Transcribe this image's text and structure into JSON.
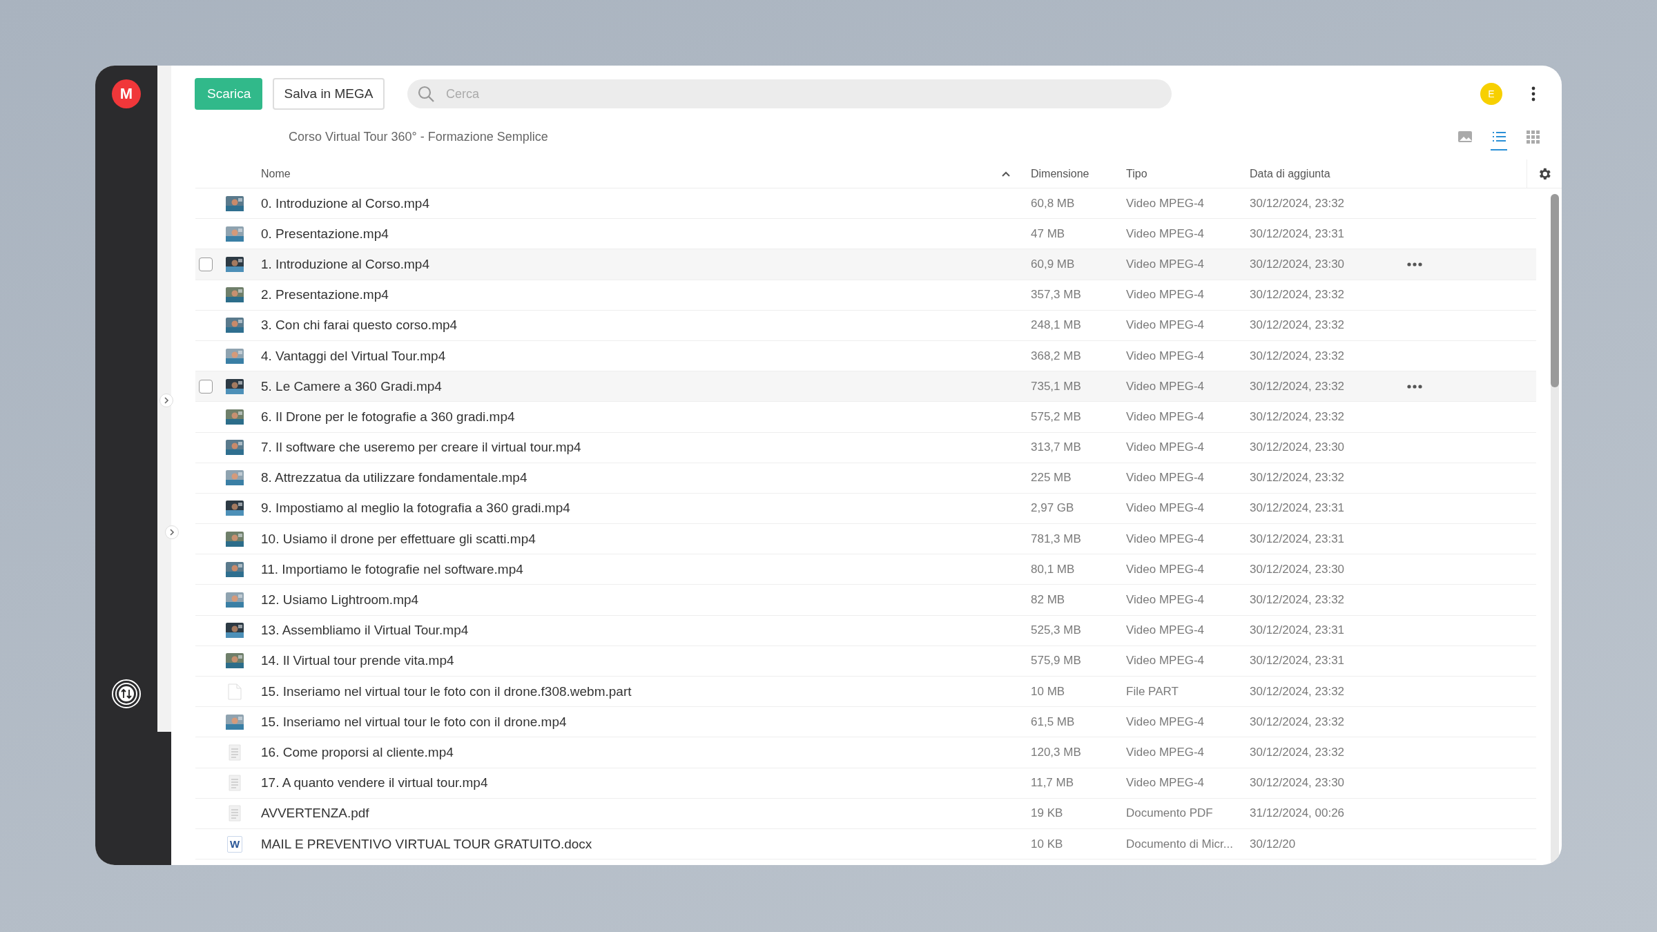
{
  "app": {
    "logo": "M"
  },
  "toolbar": {
    "buttons": [
      {
        "label": "Scarica",
        "kind": "primary"
      },
      {
        "label": "Salva in MEGA",
        "kind": "secondary"
      }
    ],
    "search": {
      "placeholder": "Cerca"
    },
    "user": {
      "initial": "E"
    }
  },
  "breadcrumb": "Corso Virtual Tour 360° - Formazione Semplice",
  "views": [
    {
      "kind": "thumbnails",
      "selected": false
    },
    {
      "kind": "list",
      "selected": true
    },
    {
      "kind": "grid",
      "selected": false
    }
  ],
  "table": {
    "columns": [
      "Nome",
      "Dimensione",
      "Tipo",
      "Data di aggiunta"
    ],
    "rows": [
      {
        "name": "0. Introduzione al Corso.mp4",
        "size": "60,8 MB",
        "type": "Video MPEG-4",
        "date": "30/12/2024, 23:32",
        "kind": "picture",
        "hovered": false
      },
      {
        "name": "0. Presentazione.mp4",
        "size": "47 MB",
        "type": "Video MPEG-4",
        "date": "30/12/2024, 23:31",
        "kind": "picture",
        "hovered": false
      },
      {
        "name": "1. Introduzione al Corso.mp4",
        "size": "60,9 MB",
        "type": "Video MPEG-4",
        "date": "30/12/2024, 23:30",
        "kind": "picture",
        "hovered": true
      },
      {
        "name": "2. Presentazione.mp4",
        "size": "357,3 MB",
        "type": "Video MPEG-4",
        "date": "30/12/2024, 23:32",
        "kind": "picture",
        "hovered": false
      },
      {
        "name": "3. Con chi farai questo corso.mp4",
        "size": "248,1 MB",
        "type": "Video MPEG-4",
        "date": "30/12/2024, 23:32",
        "kind": "picture",
        "hovered": false
      },
      {
        "name": "4. Vantaggi del Virtual Tour.mp4",
        "size": "368,2 MB",
        "type": "Video MPEG-4",
        "date": "30/12/2024, 23:32",
        "kind": "picture",
        "hovered": false
      },
      {
        "name": "5. Le Camere a 360 Gradi.mp4",
        "size": "735,1 MB",
        "type": "Video MPEG-4",
        "date": "30/12/2024, 23:32",
        "kind": "picture",
        "hovered": true
      },
      {
        "name": "6. Il Drone per le fotografie a 360 gradi.mp4",
        "size": "575,2 MB",
        "type": "Video MPEG-4",
        "date": "30/12/2024, 23:32",
        "kind": "picture",
        "hovered": false
      },
      {
        "name": "7. Il software che useremo per creare il virtual tour.mp4",
        "size": "313,7 MB",
        "type": "Video MPEG-4",
        "date": "30/12/2024, 23:30",
        "kind": "picture",
        "hovered": false
      },
      {
        "name": "8. Attrezzatua da utilizzare fondamentale.mp4",
        "size": "225 MB",
        "type": "Video MPEG-4",
        "date": "30/12/2024, 23:32",
        "kind": "picture",
        "hovered": false
      },
      {
        "name": "9. Impostiamo al meglio la fotografia a 360 gradi.mp4",
        "size": "2,97 GB",
        "type": "Video MPEG-4",
        "date": "30/12/2024, 23:31",
        "kind": "picture",
        "hovered": false
      },
      {
        "name": "10. Usiamo il drone per effettuare gli scatti.mp4",
        "size": "781,3 MB",
        "type": "Video MPEG-4",
        "date": "30/12/2024, 23:31",
        "kind": "picture",
        "hovered": false
      },
      {
        "name": "11. Importiamo le fotografie nel software.mp4",
        "size": "80,1 MB",
        "type": "Video MPEG-4",
        "date": "30/12/2024, 23:30",
        "kind": "picture",
        "hovered": false
      },
      {
        "name": "12. Usiamo Lightroom.mp4",
        "size": "82 MB",
        "type": "Video MPEG-4",
        "date": "30/12/2024, 23:32",
        "kind": "picture",
        "hovered": false
      },
      {
        "name": "13. Assembliamo il Virtual Tour.mp4",
        "size": "525,3 MB",
        "type": "Video MPEG-4",
        "date": "30/12/2024, 23:31",
        "kind": "picture",
        "hovered": false
      },
      {
        "name": "14. Il Virtual tour prende vita.mp4",
        "size": "575,9 MB",
        "type": "Video MPEG-4",
        "date": "30/12/2024, 23:31",
        "kind": "picture",
        "hovered": false
      },
      {
        "name": "15. Inseriamo nel virtual tour le foto con il drone.f308.webm.part",
        "size": "10 MB",
        "type": "File PART",
        "date": "30/12/2024, 23:32",
        "kind": "blank",
        "hovered": false
      },
      {
        "name": "15. Inseriamo nel virtual tour le foto con il drone.mp4",
        "size": "61,5 MB",
        "type": "Video MPEG-4",
        "date": "30/12/2024, 23:32",
        "kind": "picture",
        "hovered": false
      },
      {
        "name": "16. Come proporsi al cliente.mp4",
        "size": "120,3 MB",
        "type": "Video MPEG-4",
        "date": "30/12/2024, 23:32",
        "kind": "doc",
        "hovered": false
      },
      {
        "name": "17. A quanto vendere il virtual tour.mp4",
        "size": "11,7 MB",
        "type": "Video MPEG-4",
        "date": "30/12/2024, 23:30",
        "kind": "doc",
        "hovered": false
      },
      {
        "name": "AVVERTENZA.pdf",
        "size": "19 KB",
        "type": "Documento PDF",
        "date": "31/12/2024, 00:26",
        "kind": "doc",
        "hovered": false
      },
      {
        "name": "MAIL E PREVENTIVO VIRTUAL TOUR GRATUITO.docx",
        "size": "10 KB",
        "type": "Documento di Micr...",
        "date": "30/12/20",
        "kind": "word",
        "icon_text": "W",
        "hovered": false
      }
    ]
  }
}
